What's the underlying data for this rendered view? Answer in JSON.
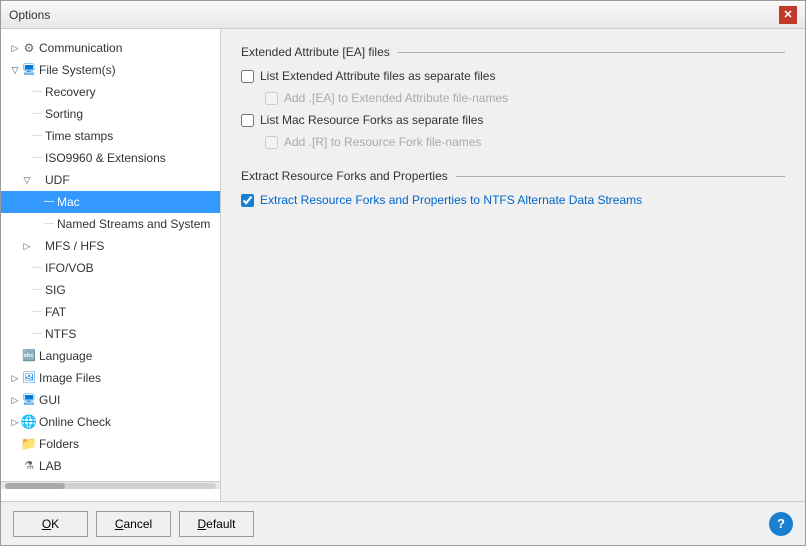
{
  "dialog": {
    "title": "Options",
    "close_label": "✕"
  },
  "tree": {
    "items": [
      {
        "id": "communication",
        "label": "Communication",
        "level": 0,
        "expanded": false,
        "has_expand": true,
        "icon": "gear",
        "selected": false
      },
      {
        "id": "filesystem",
        "label": "File System(s)",
        "level": 0,
        "expanded": true,
        "has_expand": true,
        "icon": "fs",
        "selected": false
      },
      {
        "id": "recovery",
        "label": "Recovery",
        "level": 1,
        "expanded": false,
        "has_expand": false,
        "icon": "none",
        "selected": false
      },
      {
        "id": "sorting",
        "label": "Sorting",
        "level": 1,
        "expanded": false,
        "has_expand": false,
        "icon": "none",
        "selected": false
      },
      {
        "id": "timestamps",
        "label": "Time stamps",
        "level": 1,
        "expanded": false,
        "has_expand": false,
        "icon": "none",
        "selected": false
      },
      {
        "id": "iso9960",
        "label": "ISO9960 & Extensions",
        "level": 1,
        "expanded": false,
        "has_expand": false,
        "icon": "none",
        "selected": false
      },
      {
        "id": "udf",
        "label": "UDF",
        "level": 1,
        "expanded": true,
        "has_expand": true,
        "icon": "none",
        "selected": false
      },
      {
        "id": "mac",
        "label": "Mac",
        "level": 2,
        "expanded": false,
        "has_expand": false,
        "icon": "none",
        "selected": true
      },
      {
        "id": "namedstreams",
        "label": "Named Streams and System",
        "level": 2,
        "expanded": false,
        "has_expand": false,
        "icon": "none",
        "selected": false
      },
      {
        "id": "mfs",
        "label": "MFS / HFS",
        "level": 1,
        "expanded": false,
        "has_expand": true,
        "icon": "none",
        "selected": false
      },
      {
        "id": "ifo",
        "label": "IFO/VOB",
        "level": 1,
        "expanded": false,
        "has_expand": false,
        "icon": "none",
        "selected": false
      },
      {
        "id": "sig",
        "label": "SIG",
        "level": 1,
        "expanded": false,
        "has_expand": false,
        "icon": "none",
        "selected": false
      },
      {
        "id": "fat",
        "label": "FAT",
        "level": 1,
        "expanded": false,
        "has_expand": false,
        "icon": "none",
        "selected": false
      },
      {
        "id": "ntfs",
        "label": "NTFS",
        "level": 1,
        "expanded": false,
        "has_expand": false,
        "icon": "none",
        "selected": false
      },
      {
        "id": "language",
        "label": "Language",
        "level": 0,
        "expanded": false,
        "has_expand": false,
        "icon": "lang",
        "selected": false
      },
      {
        "id": "imagefiles",
        "label": "Image Files",
        "level": 0,
        "expanded": false,
        "has_expand": true,
        "icon": "img",
        "selected": false
      },
      {
        "id": "gui",
        "label": "GUI",
        "level": 0,
        "expanded": false,
        "has_expand": true,
        "icon": "fs",
        "selected": false
      },
      {
        "id": "onlinecheck",
        "label": "Online Check",
        "level": 0,
        "expanded": false,
        "has_expand": true,
        "icon": "globe",
        "selected": false
      },
      {
        "id": "folders",
        "label": "Folders",
        "level": 0,
        "expanded": false,
        "has_expand": false,
        "icon": "folder",
        "selected": false
      },
      {
        "id": "lab",
        "label": "LAB",
        "level": 0,
        "expanded": false,
        "has_expand": false,
        "icon": "lab",
        "selected": false
      }
    ]
  },
  "content": {
    "section1_title": "Extended Attribute [EA] files",
    "option1_label": "List Extended Attribute files as separate files",
    "option1_checked": false,
    "option1_enabled": true,
    "option2_label": "Add .[EA] to Extended Attribute file-names",
    "option2_checked": false,
    "option2_enabled": false,
    "option3_label": "List Mac Resource Forks as separate files",
    "option3_checked": false,
    "option3_enabled": true,
    "option4_label": "Add .[R] to Resource Fork file-names",
    "option4_checked": false,
    "option4_enabled": false,
    "section2_title": "Extract Resource Forks and Properties",
    "option5_label": "Extract Resource Forks and Properties to NTFS Alternate Data Streams",
    "option5_checked": true,
    "option5_enabled": true
  },
  "footer": {
    "ok_label": "OK",
    "cancel_label": "Cancel",
    "default_label": "Default",
    "help_label": "?"
  }
}
